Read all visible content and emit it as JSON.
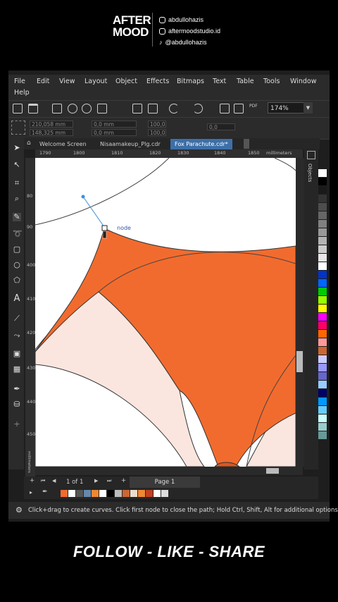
{
  "branding": {
    "logo_line1": "AFTER",
    "logo_line2": "MOOD",
    "socials": [
      {
        "icon": "instagram-icon",
        "handle": "abdullohazis"
      },
      {
        "icon": "instagram-icon",
        "handle": "aftermoodstudio.id"
      },
      {
        "icon": "tiktok-icon",
        "handle": "@abdullohazis"
      }
    ]
  },
  "menu": [
    "File",
    "Edit",
    "View",
    "Layout",
    "Object",
    "Effects",
    "Bitmaps",
    "Text",
    "Table",
    "Tools",
    "Window",
    "Help"
  ],
  "toolbar": {
    "zoom": "174%",
    "pdf_label": "PDF"
  },
  "propbar": {
    "x": "210,058 mm",
    "y": "148,325 mm",
    "w": "0,0 mm",
    "h": "0,0 mm",
    "sx": "100,0",
    "sy": "100,0",
    "angle": "0,0"
  },
  "tabs": [
    {
      "label": "Welcome Screen",
      "active": false
    },
    {
      "label": "Nisaamakeup_Plg.cdr",
      "active": false
    },
    {
      "label": "Fox Parachute.cdr*",
      "active": true
    }
  ],
  "ruler": {
    "h_ticks": [
      "1790",
      "1800",
      "1810",
      "1820",
      "1830",
      "1840",
      "1850"
    ],
    "h_unit": "millimeters",
    "v_ticks": [
      "80",
      "90",
      "400",
      "410",
      "420",
      "430",
      "440",
      "450",
      "460",
      "470"
    ],
    "v_unit": "millimeters"
  },
  "canvas": {
    "node_label": "node",
    "fill_color": "#f26b2e",
    "light_fill": "#fbe6df"
  },
  "docker": {
    "title": "Objects"
  },
  "pagenav": {
    "page_count": "1 of 1",
    "page_tab": "Page 1"
  },
  "palette_colors": [
    "#ffffff",
    "#000000",
    "#1a1a1a",
    "#333333",
    "#4d4d4d",
    "#666666",
    "#808080",
    "#999999",
    "#b3b3b3",
    "#cccccc",
    "#e6e6e6",
    "#ffffff",
    "#0033cc",
    "#0066ff",
    "#00cc00",
    "#99ff00",
    "#ffff00",
    "#ff00ff",
    "#ff0066",
    "#ff6600",
    "#ff9999",
    "#cc6633",
    "#ccccff",
    "#9999ff",
    "#6666cc",
    "#99ccff",
    "#000066",
    "#0099ff",
    "#66ccff",
    "#ccffff",
    "#99cccc",
    "#669999"
  ],
  "doc_palette": [
    "#f26b2e",
    "#ffffff",
    "#555555",
    "#6688aa",
    "#ee8833",
    "#ffffff",
    "#000000",
    "#bbbbbb",
    "#cc6633",
    "#eeddcc",
    "#ee8833",
    "#c04020",
    "#ffffff",
    "#dddddd"
  ],
  "status": {
    "hint": "Click+drag to create curves. Click first node to close the path; Hold Ctrl, Shift, Alt for additional options"
  },
  "cta": {
    "text": "FOLLOW - LIKE - SHARE"
  }
}
